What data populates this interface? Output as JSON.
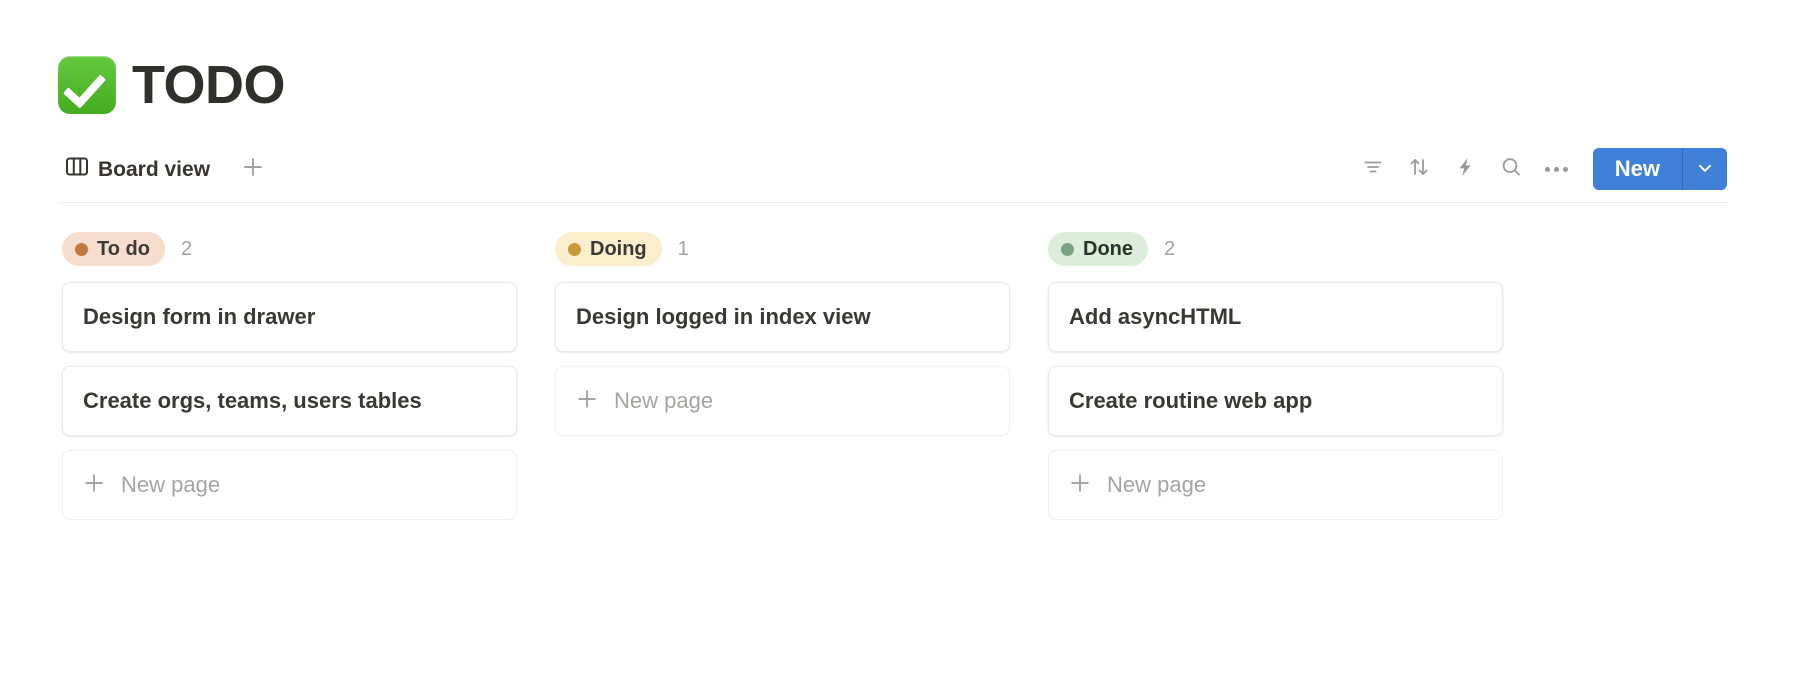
{
  "header": {
    "emoji_icon": "white-check-mark-emoji",
    "title": "TODO"
  },
  "toolbar": {
    "views": [
      {
        "label": "Board view",
        "icon": "board-view-icon",
        "active": true
      }
    ],
    "add_view_icon": "plus-icon",
    "actions": [
      {
        "name": "filter",
        "icon": "filter-icon"
      },
      {
        "name": "sort",
        "icon": "sort-arrows-icon"
      },
      {
        "name": "automations",
        "icon": "lightning-bolt-icon"
      },
      {
        "name": "search",
        "icon": "search-icon"
      },
      {
        "name": "more",
        "icon": "ellipsis-icon"
      }
    ],
    "new_button": {
      "label": "New",
      "caret_icon": "chevron-down-icon",
      "color": "#4080d9"
    }
  },
  "board": {
    "new_page_label": "New page",
    "new_page_icon": "plus-icon",
    "columns": [
      {
        "status": "To do",
        "count": "2",
        "badge_bg": "#f6ddcd",
        "badge_text": "#3b3a36",
        "dot_color": "#c2793f",
        "cards": [
          {
            "title": "Design form in drawer"
          },
          {
            "title": "Create orgs, teams, users tables"
          }
        ],
        "show_new_page": true
      },
      {
        "status": "Doing",
        "count": "1",
        "badge_bg": "#fbeecc",
        "badge_text": "#3b3a36",
        "dot_color": "#c99b3d",
        "cards": [
          {
            "title": "Design logged in index view"
          }
        ],
        "show_new_page": true
      },
      {
        "status": "Done",
        "count": "2",
        "badge_bg": "#dcedda",
        "badge_text": "#27362a",
        "dot_color": "#7aa381",
        "cards": [
          {
            "title": "Add asyncHTML"
          },
          {
            "title": "Create routine web app"
          }
        ],
        "show_new_page": true
      }
    ]
  }
}
